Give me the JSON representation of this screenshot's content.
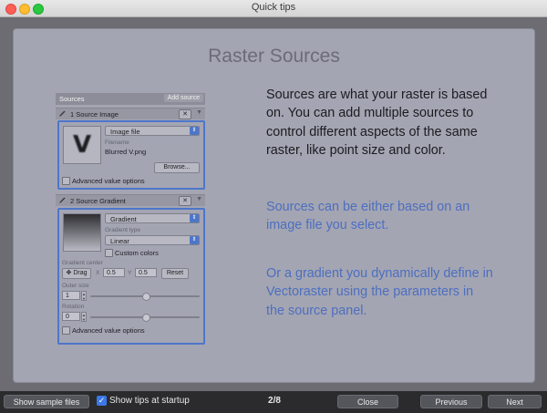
{
  "window": {
    "title": "Quick tips"
  },
  "tip": {
    "title": "Raster Sources",
    "main_text": "Sources are what your raster is based on. You can add multiple sources to control different aspects of the same raster, like point size and color.",
    "blue_text_1": "Sources can be either based on an image file you select.",
    "blue_text_2": "Or a gradient you dynamically define in Vectoraster using the parameters in the source panel."
  },
  "source_panel": {
    "header": "Sources",
    "add_button": "Add source",
    "section1": {
      "label": "1 Source Image",
      "type": "Image file",
      "filename_label": "Filename",
      "filename": "Blurred V.png",
      "thumb_letter": "V",
      "browse": "Browse...",
      "advanced": "Advanced value options"
    },
    "section2": {
      "label": "2 Source Gradient",
      "type": "Gradient",
      "gradient_type_label": "Gradient type",
      "gradient_type": "Linear",
      "custom_colors": "Custom colors",
      "center_label": "Gradient center",
      "drag": "Drag",
      "x_label": "X",
      "x_value": "0.5",
      "y_label": "Y",
      "y_value": "0.5",
      "reset": "Reset",
      "outer_size_label": "Outer size",
      "outer_size": "1",
      "rotation_label": "Rotation",
      "rotation": "0",
      "advanced": "Advanced value options",
      "outer_size_slider_fraction": 0.5,
      "rotation_slider_fraction": 0.5
    },
    "remove_symbol": "✕",
    "collapse_symbol": "▼"
  },
  "bottom": {
    "show_samples": "Show sample files",
    "show_tips_label": "Show tips at startup",
    "show_tips_checked": true,
    "page": "2/8",
    "close": "Close",
    "previous": "Previous",
    "next": "Next"
  },
  "colors": {
    "accent": "#4d76c9",
    "tip_blue_text": "#4c6fbf",
    "checkbox_blue": "#3b78e7"
  }
}
